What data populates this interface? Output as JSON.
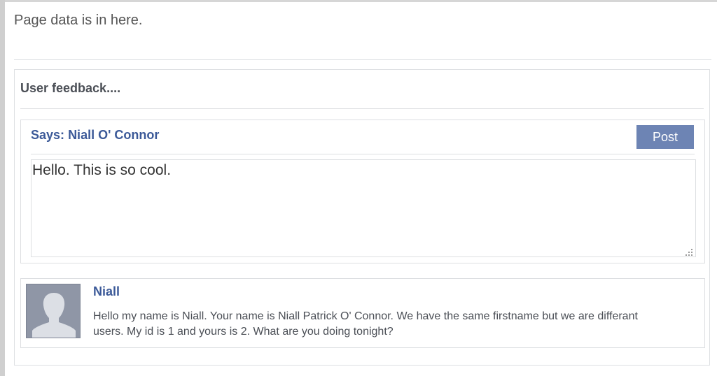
{
  "page": {
    "intro_text": "Page data is in here."
  },
  "feedback": {
    "title": "User feedback....",
    "compose": {
      "says_label": "Says:",
      "author_name": "Niall O' Connor",
      "post_label": "Post",
      "text_value": "Hello. This is so cool."
    },
    "comments": [
      {
        "author": "Niall",
        "avatar_icon": "default-user-silhouette-icon",
        "body": "Hello my name is Niall. Your name is Niall Patrick O' Connor. We have the same firstname but we are differant users. My id is 1 and yours is 2. What are you doing tonight?"
      }
    ]
  },
  "colors": {
    "link_blue": "#3b5998",
    "button_blue": "#6d84b4",
    "border_gray": "#dddfe2",
    "avatar_gray": "#8f96a6"
  }
}
